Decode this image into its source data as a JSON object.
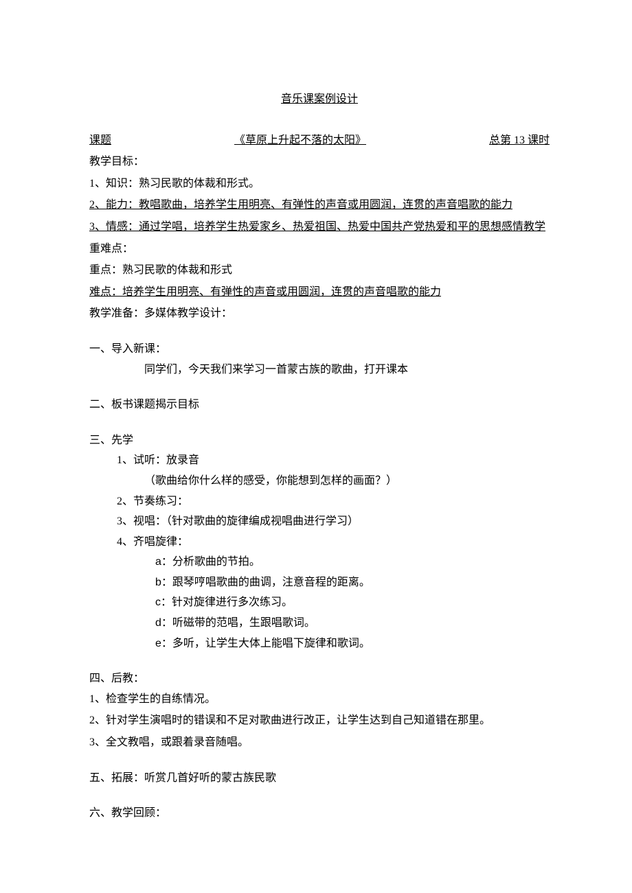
{
  "title": "音乐课案例设计",
  "topicLine": {
    "label": "课题",
    "songTitle": "《草原上升起不落的太阳》",
    "lessonCount": "总第 13 课时"
  },
  "objectives": {
    "heading": "教学目标：",
    "knowledge": "1、知识：熟习民歌的体裁和形式。",
    "ability": "2、能力：教唱歌曲，培养学生用明亮、有弹性的声音或用圆润，连贯的声音唱歌的能力",
    "emotion": "3、情感：通过学唱，培养学生热爱家乡、热爱祖国、热爱中国共产党热爱和平的思想感情教学"
  },
  "keyDiff": {
    "heading": "重难点：",
    "key": "重点：熟习民歌的体裁和形式",
    "diff": "难点：培养学生用明亮、有弹性的声音或用圆润，连贯的声音唱歌的能力"
  },
  "prep": "教学准备：多媒体教学设计：",
  "s1": {
    "heading": "一、导入新课：",
    "line1": "同学们，今天我们来学习一首蒙古族的歌曲，打开课本"
  },
  "s2": "二、板书课题揭示目标",
  "s3": {
    "heading": "三、先学",
    "i1a": "1、试听：放录音",
    "i1b": "（歌曲给你什么样的感受，你能想到怎样的画面？）",
    "i2": "2、节奏练习：",
    "i3": "3、视唱：（针对歌曲的旋律编成视唱曲进行学习）",
    "i4": "4、齐唱旋律：",
    "a": "a：分析歌曲的节拍。",
    "b": "b：跟琴哼唱歌曲的曲调，注意音程的距离。",
    "c": "c：针对旋律进行多次练习。",
    "d": "d：听磁带的范唱，生跟唱歌词。",
    "e": "e：多听，让学生大体上能唱下旋律和歌词。"
  },
  "s4": {
    "heading": "四、后教：",
    "i1": "1、检查学生的自练情况。",
    "i2": "2、针对学生演唱时的错误和不足对歌曲进行改正，让学生达到自己知道错在那里。",
    "i3": "3、全文教唱，或跟着录音随唱。"
  },
  "s5": "五、拓展：听赏几首好听的蒙古族民歌",
  "s6": "六、教学回顾："
}
